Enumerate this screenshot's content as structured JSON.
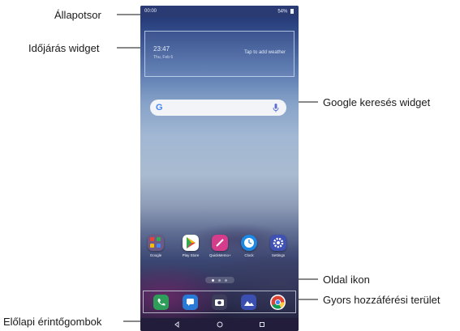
{
  "labels": {
    "status_bar": "Állapotsor",
    "weather_widget": "Időjárás widget",
    "google_search_widget": "Google keresés widget",
    "page_icon": "Oldal ikon",
    "quick_access": "Gyors hozzáférési terület",
    "front_touch_buttons": "Előlapi érintőgombok"
  },
  "phone": {
    "status_bar": {
      "time": "00:00",
      "right": "54% "
    },
    "weather": {
      "time": "23:47",
      "date": "Thu, Feb 6",
      "tap_text": "Tap to add weather"
    },
    "search": {
      "logo": "G"
    },
    "apps": [
      {
        "name": "Google",
        "icon": "google-folder-icon",
        "color": "#7a5a8a"
      },
      {
        "name": "Play Store",
        "icon": "play-store-icon",
        "color": "#ffffff"
      },
      {
        "name": "QuickMemo+",
        "icon": "quickmemo-icon",
        "color": "#d63c8c"
      },
      {
        "name": "Clock",
        "icon": "clock-icon",
        "color": "#1e88e5"
      },
      {
        "name": "Settings",
        "icon": "settings-icon",
        "color": "#3f51b5"
      }
    ],
    "dock": [
      {
        "icon": "phone-icon",
        "color": "#2e9d5a"
      },
      {
        "icon": "messages-icon",
        "color": "#2979d6"
      },
      {
        "icon": "camera-icon",
        "color": "#3d3d5c"
      },
      {
        "icon": "gallery-icon",
        "color": "#3a4fb0"
      },
      {
        "icon": "chrome-icon",
        "color": "#ffffff"
      }
    ]
  }
}
